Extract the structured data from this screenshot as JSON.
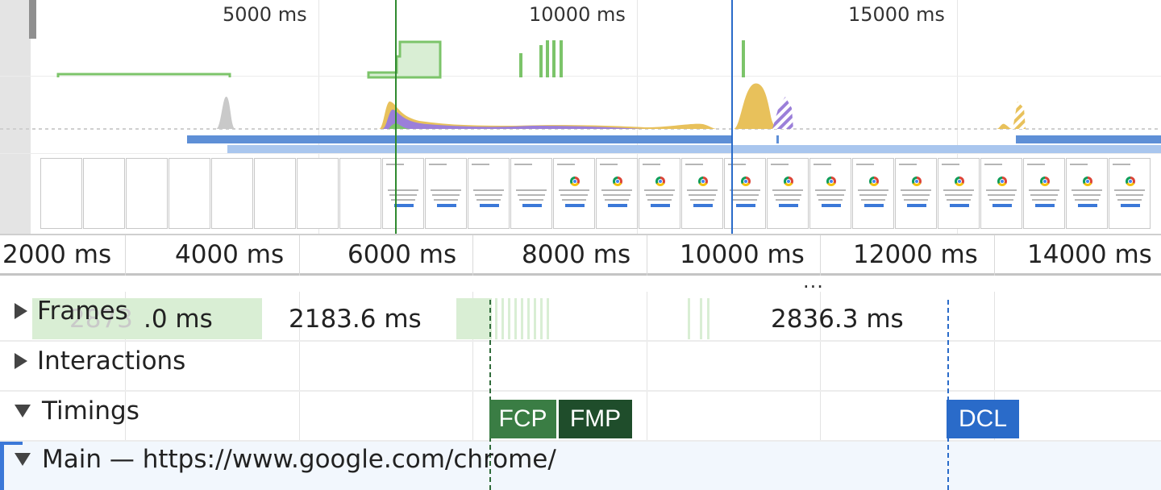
{
  "overview": {
    "ticks": [
      "5000 ms",
      "10000 ms",
      "15000 ms"
    ]
  },
  "ruler": {
    "labels": [
      "2000 ms",
      "4000 ms",
      "6000 ms",
      "8000 ms",
      "10000 ms",
      "12000 ms",
      "14000 ms"
    ]
  },
  "resize_handle": "...",
  "tracks": {
    "frames": {
      "label": "Frames",
      "durations": [
        ".0 ms",
        "2183.6 ms",
        "2836.3 ms"
      ],
      "occluded_text": "2873"
    },
    "interactions": {
      "label": "Interactions"
    },
    "timings": {
      "label": "Timings",
      "markers": [
        {
          "label": "FCP",
          "color": "#3a7d44"
        },
        {
          "label": "FMP",
          "color": "#1f4d2b"
        },
        {
          "label": "DCL",
          "color": "#2a6bc9"
        }
      ]
    },
    "main": {
      "label": "Main — https://www.google.com/chrome/"
    }
  },
  "colors": {
    "fps_green": "#7cc46a",
    "cpu_scripting": "#e8c15b",
    "cpu_rendering": "#9b7fd9",
    "cpu_painting": "#7cc46a",
    "network_primary": "#5e8fd6",
    "network_secondary": "#a9c6ee",
    "selection": "#3b78d8"
  },
  "icons": {
    "collapsed": "triangle-right-icon",
    "expanded": "triangle-down-icon"
  }
}
